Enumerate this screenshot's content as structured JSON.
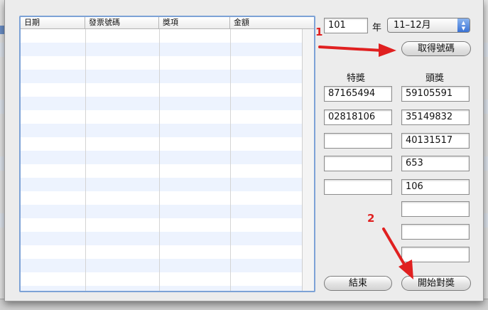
{
  "table": {
    "columns": [
      "日期",
      "發票號碼",
      "獎項",
      "金額"
    ]
  },
  "controls": {
    "year_value": "101",
    "year_label": "年",
    "period_selected": "11–12月",
    "get_numbers_button": "取得號碼",
    "special_prize_header": "特獎",
    "grand_prize_header": "頭獎",
    "special_prize_fields": [
      "87165494",
      "02818106",
      "",
      "",
      ""
    ],
    "grand_prize_fields": [
      "59105591",
      "35149832",
      "40131517",
      "653",
      "106",
      "",
      "",
      ""
    ],
    "end_button": "結束",
    "start_check_button": "開始對獎"
  },
  "annotations": {
    "step1": "1",
    "step2": "2",
    "color": "#e02020"
  },
  "colors": {
    "table_border": "#7da2d6",
    "row_stripe": "#edf3fe",
    "select_accent": "#3b73d6"
  }
}
